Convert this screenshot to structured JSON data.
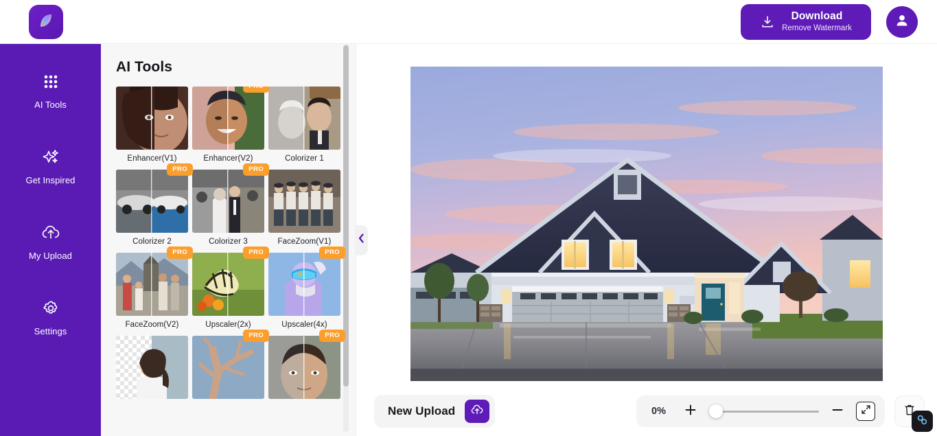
{
  "header": {
    "logo_icon": "leaf-logo-icon",
    "download": {
      "icon": "download-icon",
      "title": "Download",
      "subtitle": "Remove Watermark"
    },
    "account": {
      "icon": "user-avatar-icon"
    }
  },
  "sidebar": {
    "items": [
      {
        "label": "AI Tools",
        "icon": "grid-dots-icon"
      },
      {
        "label": "Get Inspired",
        "icon": "sparkles-icon"
      },
      {
        "label": "My Upload",
        "icon": "cloud-upload-icon"
      },
      {
        "label": "Settings",
        "icon": "gear-icon"
      }
    ]
  },
  "tools_panel": {
    "title": "AI Tools",
    "collapse_icon": "chevron-left-icon",
    "pro_label": "PRO",
    "tools": [
      {
        "label": "Enhancer(V1)",
        "pro": false,
        "thumb": "portrait-woman-split"
      },
      {
        "label": "Enhancer(V2)",
        "pro": true,
        "thumb": "portrait-man-smiling-split"
      },
      {
        "label": "Colorizer 1",
        "pro": false,
        "thumb": "vintage-wedding-couple-split"
      },
      {
        "label": "Colorizer 2",
        "pro": true,
        "thumb": "classic-cars-split"
      },
      {
        "label": "Colorizer 3",
        "pro": true,
        "thumb": "old-wedding-crowd-split"
      },
      {
        "label": "FaceZoom(V1)",
        "pro": false,
        "thumb": "vintage-boys-group-split"
      },
      {
        "label": "FaceZoom(V2)",
        "pro": true,
        "thumb": "family-monument-split"
      },
      {
        "label": "Upscaler(2x)",
        "pro": true,
        "thumb": "butterfly-flower-split"
      },
      {
        "label": "Upscaler(4x)",
        "pro": true,
        "thumb": "skier-goggles-split"
      },
      {
        "label": "",
        "pro": false,
        "thumb": "background-remove-woman"
      },
      {
        "label": "",
        "pro": true,
        "thumb": "tree-branches-split"
      },
      {
        "label": "",
        "pro": true,
        "thumb": "old-portrait-boy-split"
      }
    ]
  },
  "canvas": {
    "image_alt": "suburban-house-at-dusk"
  },
  "bottom_bar": {
    "new_upload_label": "New Upload",
    "upload_icon": "cloud-upload-icon",
    "zoom_percent": "0%",
    "zoom_in_icon": "plus-icon",
    "zoom_out_icon": "minus-icon",
    "slider_value": 0,
    "fit_icon": "expand-arrows-icon",
    "delete_icon": "trash-icon"
  },
  "floating_badge": {
    "icon": "link-chain-icon"
  },
  "colors": {
    "brand_purple": "#5a1bb5",
    "button_purple": "#5e1bb8",
    "pro_orange": "#fa9e2c",
    "panel_bg": "#f7f7f8",
    "text_dark": "#15161a"
  }
}
